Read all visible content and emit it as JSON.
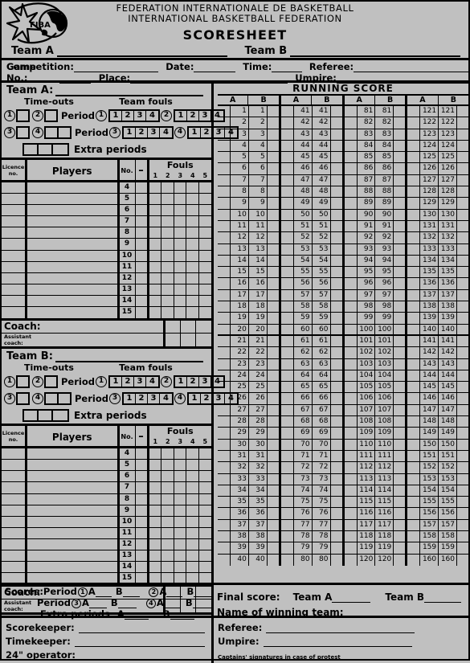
{
  "header": {
    "logo_text": "FIBA",
    "federation_fr": "FEDERATION INTERNATIONALE DE BASKETBALL",
    "federation_en": "INTERNATIONAL BASKETBALL FEDERATION",
    "title": "SCORESHEET",
    "team_a_label": "Team A",
    "team_b_label": "Team B"
  },
  "info": {
    "competition": "Competition:",
    "date": "Date:",
    "time": "Time:",
    "referee": "Referee:",
    "game_no": "Game No.:",
    "place": "Place:",
    "umpire": "Umpire:"
  },
  "team_a": {
    "title": "Team A:",
    "timeouts_label": "Time-outs",
    "team_fouls_label": "Team fouls",
    "period_label": "Period",
    "extra_periods_label": "Extra periods",
    "timeout_markers": [
      "1",
      "2",
      "3",
      "4"
    ],
    "period_markers": [
      "1",
      "2",
      "3",
      "4"
    ],
    "foul_numbers": [
      "1",
      "2",
      "3",
      "4"
    ]
  },
  "team_b": {
    "title": "Team B:",
    "timeouts_label": "Time-outs",
    "team_fouls_label": "Team fouls",
    "period_label": "Period",
    "extra_periods_label": "Extra periods",
    "timeout_markers": [
      "1",
      "2",
      "3",
      "4"
    ],
    "period_markers": [
      "1",
      "2",
      "3",
      "4"
    ],
    "foul_numbers": [
      "1",
      "2",
      "3",
      "4"
    ]
  },
  "players_table": {
    "licence_header_line1": "Licence",
    "licence_header_line2": "no.",
    "players_header": "Players",
    "no_header": "No.",
    "dash_header": "–",
    "fouls_header": "Fouls",
    "foul_columns": [
      "1",
      "2",
      "3",
      "4",
      "5"
    ],
    "player_numbers": [
      "4",
      "5",
      "6",
      "7",
      "8",
      "9",
      "10",
      "11",
      "12",
      "13",
      "14",
      "15"
    ],
    "coach_label": "Coach:",
    "assistant_coach_line1": "Assistant",
    "assistant_coach_line2": "coach:"
  },
  "running_score": {
    "title": "RUNNING SCORE",
    "column_a": "A",
    "column_b": "B",
    "blocks": [
      {
        "start": 1,
        "end": 40
      },
      {
        "start": 41,
        "end": 80
      },
      {
        "start": 81,
        "end": 120
      },
      {
        "start": 121,
        "end": 160
      }
    ],
    "rows_per_block": 40,
    "major_separator_every": 20
  },
  "scores_footer": {
    "scores_label": "Scores:",
    "period_label": "Period",
    "extra_periods_label": "Extra periods",
    "a_label": "A",
    "b_label": "B",
    "period_markers": [
      "1",
      "2",
      "3",
      "4"
    ]
  },
  "final_score": {
    "final_score_label": "Final score:",
    "team_a_label": "Team A",
    "team_b_label": "Team B",
    "winning_team_label": "Name of winning team:"
  },
  "signatures": {
    "scorekeeper": "Scorekeeper:",
    "timekeeper": "Timekeeper:",
    "operator": "24\" operator:",
    "referee": "Referee:",
    "umpire": "Umpire:",
    "captains": "Captains' signatures in case of protest"
  },
  "colors": {
    "background": "#c0c0c0",
    "ink": "#000000"
  }
}
